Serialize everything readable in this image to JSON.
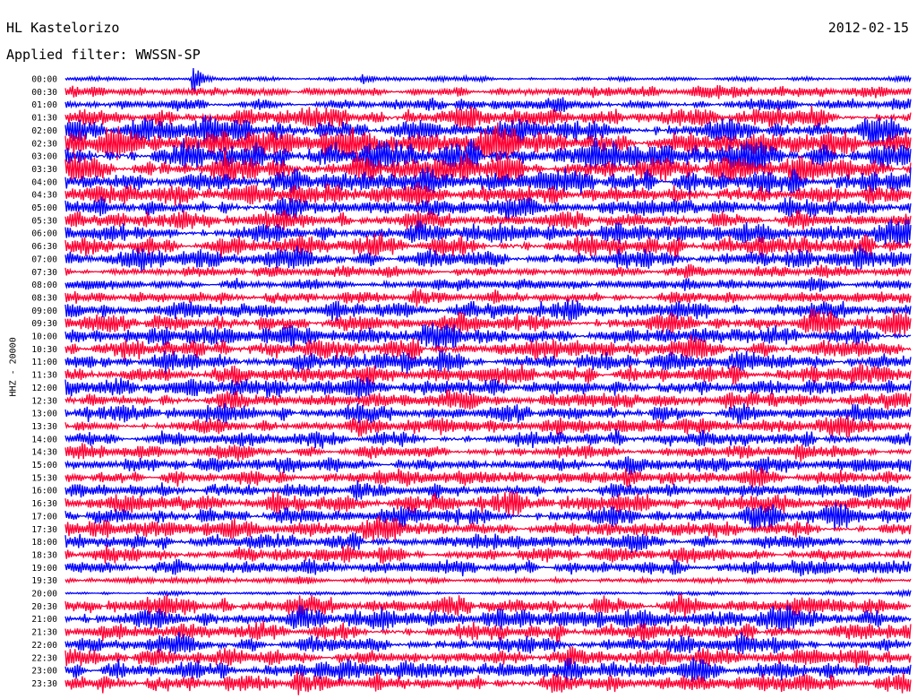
{
  "header": {
    "station": "HL Kastelorizo",
    "date": "2012-02-15",
    "filter": "Applied filter: WWSSN-SP"
  },
  "chart_data": {
    "type": "line",
    "title": "HL Kastelorizo",
    "date": "2012-02-15",
    "ylabel": "HHZ - 20000",
    "xlabel": "",
    "colors": [
      "#0000ff",
      "#ff0033"
    ],
    "grid": false,
    "legend": "none",
    "row_labels": [
      "00:00",
      "00:30",
      "01:00",
      "01:30",
      "02:00",
      "02:30",
      "03:00",
      "03:30",
      "04:00",
      "04:30",
      "05:00",
      "05:30",
      "06:00",
      "06:30",
      "07:00",
      "07:30",
      "08:00",
      "08:30",
      "09:00",
      "09:30",
      "10:00",
      "10:30",
      "11:00",
      "11:30",
      "12:00",
      "12:30",
      "13:00",
      "13:30",
      "14:00",
      "14:30",
      "15:00",
      "15:30",
      "16:00",
      "16:30",
      "17:00",
      "17:30",
      "18:00",
      "18:30",
      "19:00",
      "19:30",
      "20:00",
      "20:30",
      "21:00",
      "21:30",
      "22:00",
      "22:30",
      "23:00",
      "23:30"
    ],
    "row_amplitude": [
      0.2,
      0.5,
      0.6,
      1.0,
      1.2,
      1.4,
      1.5,
      1.4,
      1.2,
      1.0,
      1.0,
      0.9,
      1.0,
      1.1,
      1.0,
      0.6,
      0.5,
      0.7,
      0.9,
      1.0,
      1.0,
      1.0,
      1.0,
      0.9,
      0.9,
      0.9,
      0.9,
      0.8,
      0.8,
      0.7,
      0.8,
      0.7,
      0.8,
      1.0,
      1.0,
      0.9,
      0.8,
      0.8,
      0.7,
      0.3,
      0.2,
      1.0,
      1.0,
      0.9,
      0.9,
      0.9,
      0.9,
      1.0
    ],
    "events": [
      {
        "row": 0,
        "time_fraction": 0.35,
        "amplitude": 4.0,
        "label": ""
      },
      {
        "row": 0,
        "time_fraction": 0.15,
        "amplitude": 12.0,
        "label": ""
      }
    ]
  }
}
